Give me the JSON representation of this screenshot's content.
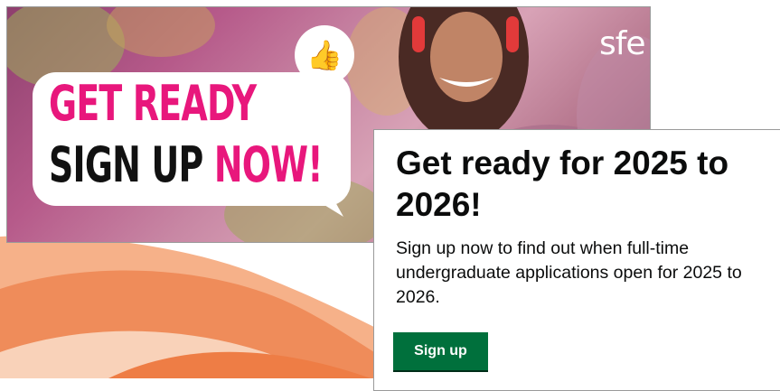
{
  "hero": {
    "headline_line1": "GET READY",
    "headline_line2_black": "SIGN UP",
    "headline_line2_pink": "NOW!",
    "thumb_icon": "thumbs-up-icon",
    "brand": "sfe",
    "colors": {
      "pink": "#e8177c",
      "bubble": "#ffffff"
    }
  },
  "card": {
    "title": "Get ready for 2025 to 2026!",
    "body": "Sign up now to find out when full-time undergraduate applications open for 2025 to 2026.",
    "button_label": "Sign up",
    "colors": {
      "button": "#00703c",
      "text": "#0b0c0c"
    }
  }
}
